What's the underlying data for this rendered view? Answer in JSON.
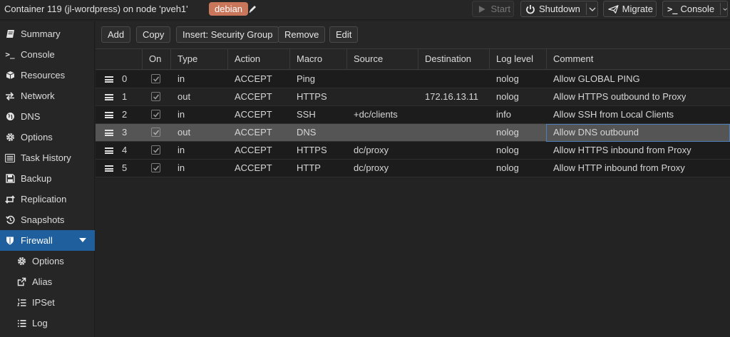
{
  "header": {
    "title": "Container 119 (jl-wordpress) on node 'pveh1'",
    "tag": "debian",
    "tag_color": "#c9765a",
    "edit_tags_icon": "pencil-icon",
    "buttons": {
      "start": "Start",
      "shutdown": "Shutdown",
      "migrate": "Migrate",
      "console": "Console"
    }
  },
  "sidebar": {
    "accent": "#1f5f9e",
    "items": [
      {
        "label": "Summary",
        "icon": "book-icon"
      },
      {
        "label": "Console",
        "icon": "terminal-icon"
      },
      {
        "label": "Resources",
        "icon": "cube-icon"
      },
      {
        "label": "Network",
        "icon": "exchange-icon"
      },
      {
        "label": "DNS",
        "icon": "globe-icon"
      },
      {
        "label": "Options",
        "icon": "gear-icon"
      },
      {
        "label": "Task History",
        "icon": "list-alt-icon"
      },
      {
        "label": "Backup",
        "icon": "floppy-icon"
      },
      {
        "label": "Replication",
        "icon": "retweet-icon"
      },
      {
        "label": "Snapshots",
        "icon": "history-icon"
      },
      {
        "label": "Firewall",
        "icon": "shield-icon"
      },
      {
        "label": "Options",
        "icon": "gear-icon"
      },
      {
        "label": "Alias",
        "icon": "external-link-icon"
      },
      {
        "label": "IPSet",
        "icon": "list-ol-icon"
      },
      {
        "label": "Log",
        "icon": "list-icon"
      }
    ]
  },
  "toolbar": {
    "add": "Add",
    "copy": "Copy",
    "insert_security_group": "Insert: Security Group",
    "remove": "Remove",
    "edit": "Edit"
  },
  "grid": {
    "columns": [
      "On",
      "Type",
      "Action",
      "Macro",
      "Source",
      "Destination",
      "Log level",
      "Comment"
    ],
    "selected_row": 3,
    "rows": [
      {
        "num": "0",
        "on": true,
        "type": "in",
        "action": "ACCEPT",
        "macro": "Ping",
        "source": "",
        "destination": "",
        "log": "nolog",
        "comment": "Allow GLOBAL PING"
      },
      {
        "num": "1",
        "on": true,
        "type": "out",
        "action": "ACCEPT",
        "macro": "HTTPS",
        "source": "",
        "destination": "172.16.13.11",
        "log": "nolog",
        "comment": "Allow HTTPS outbound to Proxy"
      },
      {
        "num": "2",
        "on": true,
        "type": "in",
        "action": "ACCEPT",
        "macro": "SSH",
        "source": "+dc/clients",
        "destination": "",
        "log": "info",
        "comment": "Allow SSH from Local Clients"
      },
      {
        "num": "3",
        "on": true,
        "type": "out",
        "action": "ACCEPT",
        "macro": "DNS",
        "source": "",
        "destination": "",
        "log": "nolog",
        "comment": "Allow DNS outbound"
      },
      {
        "num": "4",
        "on": true,
        "type": "in",
        "action": "ACCEPT",
        "macro": "HTTPS",
        "source": "dc/proxy",
        "destination": "",
        "log": "nolog",
        "comment": "Allow HTTPS inbound from Proxy"
      },
      {
        "num": "5",
        "on": true,
        "type": "in",
        "action": "ACCEPT",
        "macro": "HTTP",
        "source": "dc/proxy",
        "destination": "",
        "log": "nolog",
        "comment": "Allow HTTP inbound from Proxy"
      }
    ]
  }
}
